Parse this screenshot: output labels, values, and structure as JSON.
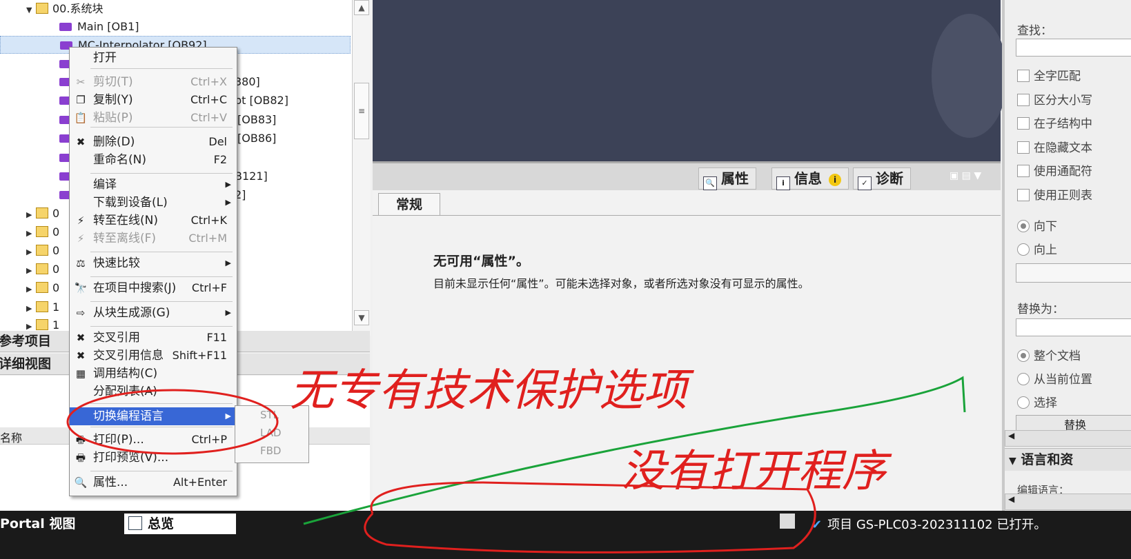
{
  "tree": {
    "root_folder": "00.系统块",
    "rows": [
      {
        "label": "Main [OB1]"
      },
      {
        "label": "MC-Interpolator [OB92]"
      },
      {
        "label": ""
      },
      {
        "label": "380]"
      },
      {
        "label": "pt [OB82]"
      },
      {
        "label": "[OB83]"
      },
      {
        "label": "[OB86]"
      },
      {
        "label": ""
      },
      {
        "label": "B121]"
      },
      {
        "label": "2]"
      }
    ],
    "folders": [
      "0",
      "0",
      "0",
      "0",
      "0",
      "1",
      "1"
    ]
  },
  "left_panes": {
    "reference_projects": "参考项目",
    "details_view": "详细视图",
    "name_col": "名称"
  },
  "context_menu": {
    "items": [
      {
        "label": "打开",
        "shortcut": "",
        "icon": "",
        "disabled": false
      },
      {
        "label": "剪切(T)",
        "shortcut": "Ctrl+X",
        "icon": "scissors-icon",
        "disabled": true
      },
      {
        "label": "复制(Y)",
        "shortcut": "Ctrl+C",
        "icon": "copy-icon",
        "disabled": false
      },
      {
        "label": "粘贴(P)",
        "shortcut": "Ctrl+V",
        "icon": "paste-icon",
        "disabled": true
      },
      {
        "label": "删除(D)",
        "shortcut": "Del",
        "icon": "delete-icon",
        "disabled": false
      },
      {
        "label": "重命名(N)",
        "shortcut": "F2",
        "icon": "",
        "disabled": false
      },
      {
        "label": "编译",
        "shortcut": "",
        "icon": "",
        "submenu": true
      },
      {
        "label": "下载到设备(L)",
        "shortcut": "",
        "icon": "",
        "submenu": true
      },
      {
        "label": "转至在线(N)",
        "shortcut": "Ctrl+K",
        "icon": "go-online-icon",
        "disabled": false
      },
      {
        "label": "转至离线(F)",
        "shortcut": "Ctrl+M",
        "icon": "go-offline-icon",
        "disabled": true
      },
      {
        "label": "快速比较",
        "shortcut": "",
        "icon": "compare-icon",
        "submenu": true
      },
      {
        "label": "在项目中搜索(J)",
        "shortcut": "Ctrl+F",
        "icon": "binoculars-icon",
        "disabled": false
      },
      {
        "label": "从块生成源(G)",
        "shortcut": "",
        "icon": "generate-source-icon",
        "submenu": true
      },
      {
        "label": "交叉引用",
        "shortcut": "F11",
        "icon": "cross-reference-icon",
        "disabled": false
      },
      {
        "label": "交叉引用信息",
        "shortcut": "Shift+F11",
        "icon": "cross-reference-info-icon",
        "disabled": false
      },
      {
        "label": "调用结构(C)",
        "shortcut": "",
        "icon": "call-structure-icon",
        "disabled": false
      },
      {
        "label": "分配列表(A)",
        "shortcut": "",
        "icon": "",
        "disabled": false
      },
      {
        "label": "切换编程语言",
        "shortcut": "",
        "icon": "",
        "submenu": true,
        "highlighted": true
      },
      {
        "label": "打印(P)...",
        "shortcut": "Ctrl+P",
        "icon": "print-icon",
        "disabled": false
      },
      {
        "label": "打印预览(V)...",
        "shortcut": "",
        "icon": "print-preview-icon",
        "disabled": false
      },
      {
        "label": "属性...",
        "shortcut": "Alt+Enter",
        "icon": "properties-icon",
        "disabled": false
      }
    ]
  },
  "submenu": {
    "items": [
      "STL",
      "LAD",
      "FBD"
    ]
  },
  "inspector": {
    "tabs": [
      "属性",
      "信息",
      "诊断"
    ],
    "general_tab": "常规",
    "no_props_title": "无可用“属性”。",
    "no_props_desc": "目前未显示任何“属性”。可能未选择对象，或者所选对象没有可显示的属性。"
  },
  "search_pane": {
    "find_label": "查找：",
    "options": [
      "全字匹配",
      "区分大小写",
      "在子结构中",
      "在隐藏文本",
      "使用通配符",
      "使用正则表"
    ],
    "direction": [
      "向下",
      "向上"
    ],
    "replace_label": "替换为：",
    "scope": [
      "整个文档",
      "从当前位置",
      "选择"
    ],
    "replace_button": "替换",
    "lang_section": "语言和资",
    "edit_lang": "编辑语言："
  },
  "statusbar": {
    "portal_view": "Portal 视图",
    "overview": "总览",
    "message": "项目 GS-PLC03-202311102 已打开。"
  },
  "annotations": {
    "note1": "无专有技术保护选项",
    "note2": "没有打开程序",
    "red": "#e0201e",
    "green": "#1aa33a"
  }
}
